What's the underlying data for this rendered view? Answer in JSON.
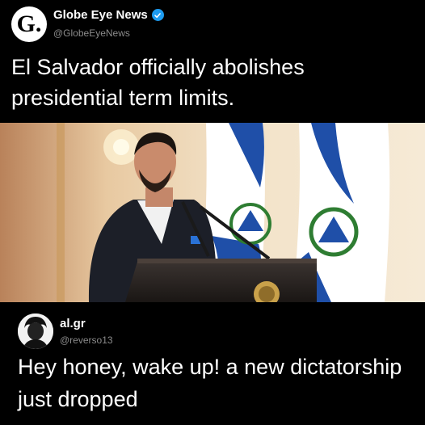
{
  "post1": {
    "avatar_letter": "G.",
    "name": "Globe Eye News",
    "handle": "@GlobeEyeNews",
    "text": "El Salvador officially abolishes presidential term limits.",
    "verified_icon": "verified-badge-icon"
  },
  "post2": {
    "name": "al.gr",
    "handle": "@reverso13",
    "text": "Hey honey, wake up! a new dictatorship just dropped"
  },
  "colors": {
    "background": "#000000",
    "verified": "#1d9bf0",
    "handle": "#8b8b8b",
    "flag_blue": "#1f4fa8"
  }
}
